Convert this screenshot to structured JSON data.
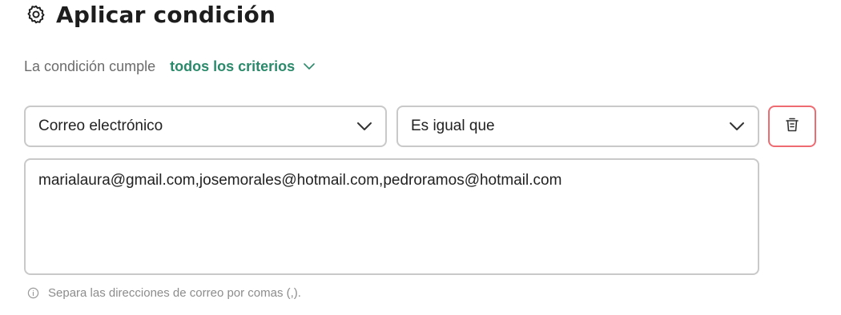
{
  "header": {
    "title": "Aplicar condición",
    "icon": "gear-icon"
  },
  "criteria": {
    "label": "La condición cumple",
    "selected": "todos los criterios",
    "accent_color": "#2b8a6b"
  },
  "condition": {
    "field_select": {
      "value": "Correo electrónico"
    },
    "operator_select": {
      "value": "Es igual que"
    },
    "delete_button": {
      "icon": "trash-icon",
      "border_color": "#ee6b72"
    },
    "emails_value": "marialaura@gmail.com,josemorales@hotmail.com,pedroramos@hotmail.com",
    "hint": "Separa las direcciones de correo por comas (,)."
  }
}
